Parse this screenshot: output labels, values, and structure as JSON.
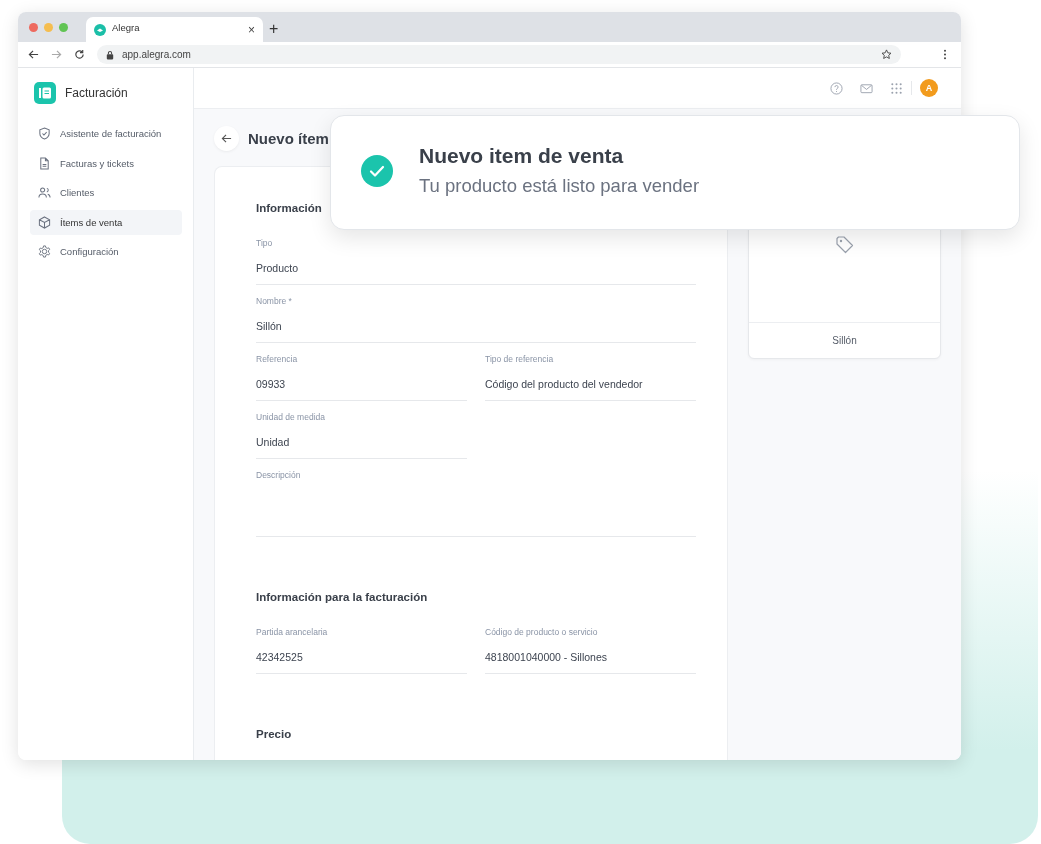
{
  "browser": {
    "tab_title": "Alegra",
    "tab_close": "×",
    "new_tab": "+",
    "url": "app.alegra.com"
  },
  "app": {
    "name": "Facturación"
  },
  "sidebar": {
    "items": [
      {
        "label": "Asistente de facturación",
        "selected": false
      },
      {
        "label": "Facturas y tickets",
        "selected": false
      },
      {
        "label": "Clientes",
        "selected": false
      },
      {
        "label": "Ítems de venta",
        "selected": true
      },
      {
        "label": "Configuración",
        "selected": false
      }
    ]
  },
  "topbar": {
    "avatar": "A"
  },
  "page": {
    "title": "Nuevo ítem"
  },
  "form": {
    "sections": [
      {
        "title": "Información",
        "fields": [
          {
            "kind": "full",
            "label": "Tipo",
            "value": "Producto"
          },
          {
            "kind": "full",
            "label": "Nombre *",
            "value": "Sillón"
          },
          {
            "kind": "half",
            "label": "Referencia",
            "value": "09933"
          },
          {
            "kind": "half",
            "label": "Tipo de referencia",
            "value": "Código del producto del vendedor"
          },
          {
            "kind": "half",
            "label": "Unidad de medida",
            "value": "Unidad"
          },
          {
            "kind": "textarea",
            "label": "Descripción"
          }
        ]
      },
      {
        "title": "Información para la facturación",
        "fields": [
          {
            "kind": "half",
            "label": "Partida arancelaria",
            "value": "42342525"
          },
          {
            "kind": "half",
            "label": "Código de producto o servicio",
            "value": "4818001040000 - Sillones"
          }
        ]
      },
      {
        "title": "Precio"
      }
    ]
  },
  "preview": {
    "name": "Sillón"
  },
  "toast": {
    "title": "Nuevo item de venta",
    "message": "Tu producto está listo para vender"
  }
}
